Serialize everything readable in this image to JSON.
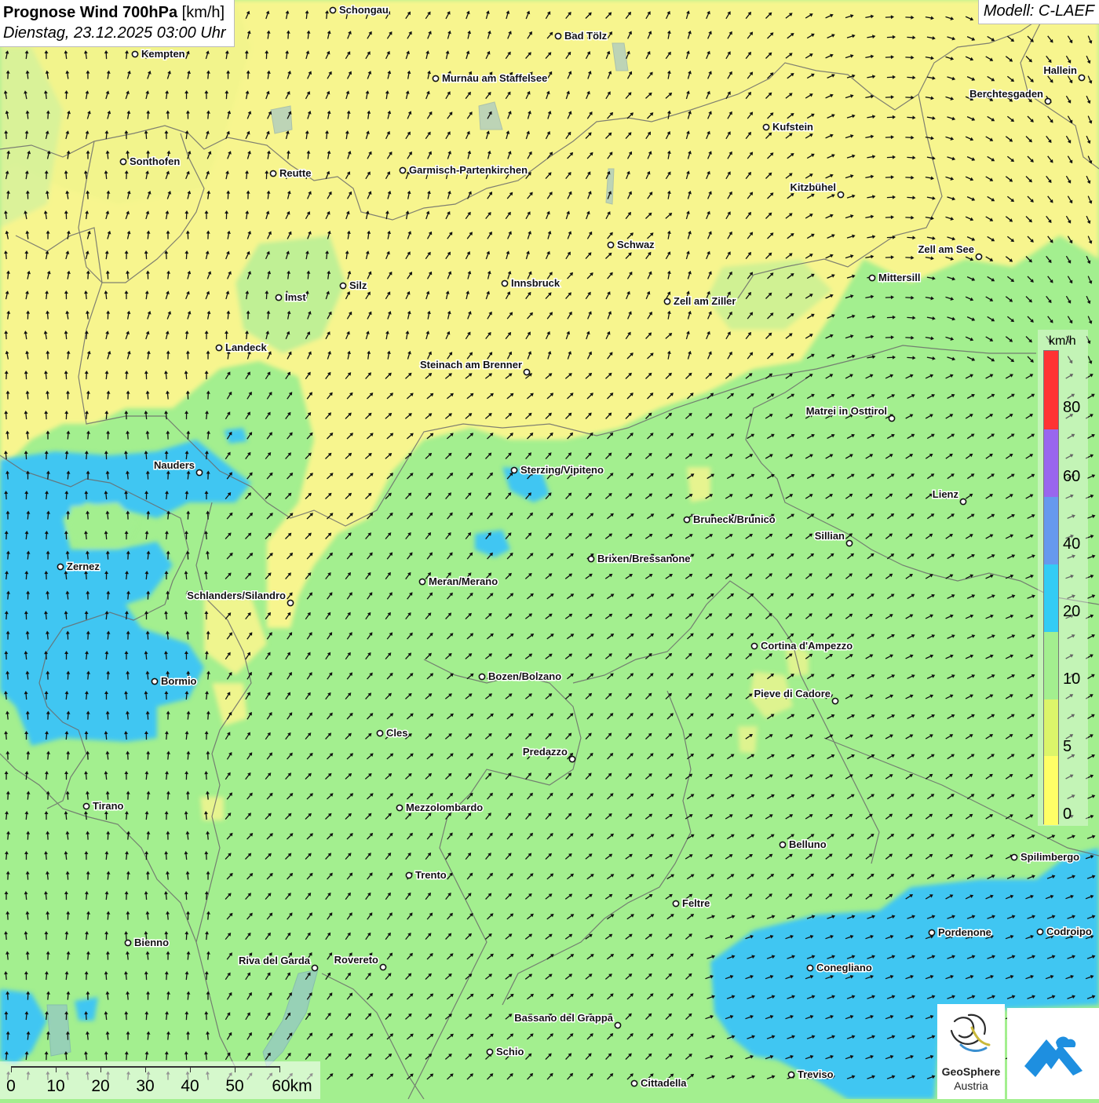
{
  "header": {
    "title_bold": "Prognose Wind 700hPa",
    "title_unit": "[km/h]",
    "datetime": "Dienstag, 23.12.2025 03:00 Uhr",
    "model": "Modell: C-LAEF"
  },
  "legend": {
    "unit": "km/h",
    "stops": [
      {
        "label": "0",
        "color": "#ffff66"
      },
      {
        "label": "5",
        "color": "#dcf56a"
      },
      {
        "label": "10",
        "color": "#a3ef8f"
      },
      {
        "label": "20",
        "color": "#33ccf5"
      },
      {
        "label": "40",
        "color": "#6699ee"
      },
      {
        "label": "60",
        "color": "#9966ee"
      },
      {
        "label": "80",
        "color": "#ff3333"
      }
    ]
  },
  "scalebar": {
    "labels": [
      "0",
      "10",
      "20",
      "30",
      "40",
      "50",
      "60km"
    ]
  },
  "colors": {
    "calm_yellow": "#f7f58e",
    "light_green": "#a3ef8f",
    "cyan_blue": "#3fc6f2",
    "border_gray": "#6b6b6b"
  },
  "places": [
    {
      "name": "Schongau",
      "side": "r"
    },
    {
      "name": "Bad Tölz",
      "side": "r"
    },
    {
      "name": "Kempten",
      "side": "r"
    },
    {
      "name": "Murnau am Staffelsee",
      "side": "r"
    },
    {
      "name": "Hallein",
      "side": "l"
    },
    {
      "name": "Berchtesgaden",
      "side": "l"
    },
    {
      "name": "Kufstein",
      "side": "r"
    },
    {
      "name": "Sonthofen",
      "side": "r"
    },
    {
      "name": "Reutte",
      "side": "r"
    },
    {
      "name": "Garmisch-Partenkirchen",
      "side": "r"
    },
    {
      "name": "Kitzbühel",
      "side": "l"
    },
    {
      "name": "Schwaz",
      "side": "r"
    },
    {
      "name": "Zell am See",
      "side": "l"
    },
    {
      "name": "Mittersill",
      "side": "r"
    },
    {
      "name": "Innsbruck",
      "side": "r"
    },
    {
      "name": "Silz",
      "side": "r"
    },
    {
      "name": "Imst",
      "side": "r"
    },
    {
      "name": "Zell am Ziller",
      "side": "r"
    },
    {
      "name": "Landeck",
      "side": "r"
    },
    {
      "name": "Steinach am Brenner",
      "side": "l"
    },
    {
      "name": "Matrei in Osttirol",
      "side": "l"
    },
    {
      "name": "Nauders",
      "side": "l"
    },
    {
      "name": "Sterzing/Vipiteno",
      "side": "r"
    },
    {
      "name": "Lienz",
      "side": "l"
    },
    {
      "name": "Bruneck/Brunico",
      "side": "r"
    },
    {
      "name": "Sillian",
      "side": "l"
    },
    {
      "name": "Zernez",
      "side": "r"
    },
    {
      "name": "Brixen/Bressanone",
      "side": "r"
    },
    {
      "name": "Meran/Merano",
      "side": "r"
    },
    {
      "name": "Schlanders/Silandro",
      "side": "l"
    },
    {
      "name": "Cortina d'Ampezzo",
      "side": "r"
    },
    {
      "name": "Bozen/Bolzano",
      "side": "r"
    },
    {
      "name": "Bormio",
      "side": "r"
    },
    {
      "name": "Pieve di Cadore",
      "side": "l"
    },
    {
      "name": "Cles",
      "side": "r"
    },
    {
      "name": "Predazzo",
      "side": "l"
    },
    {
      "name": "Tirano",
      "side": "r"
    },
    {
      "name": "Mezzolombardo",
      "side": "r"
    },
    {
      "name": "Belluno",
      "side": "r"
    },
    {
      "name": "Spilimbergo",
      "side": "r"
    },
    {
      "name": "Trento",
      "side": "r"
    },
    {
      "name": "Feltre",
      "side": "r"
    },
    {
      "name": "Pordenone",
      "side": "r"
    },
    {
      "name": "Codroipo",
      "side": "r"
    },
    {
      "name": "Bienno",
      "side": "r"
    },
    {
      "name": "Riva del Garda",
      "side": "l"
    },
    {
      "name": "Rovereto",
      "side": "l"
    },
    {
      "name": "Conegliano",
      "side": "r"
    },
    {
      "name": "Bassano del Grappa",
      "side": "l"
    },
    {
      "name": "Schio",
      "side": "r"
    },
    {
      "name": "Treviso",
      "side": "r"
    },
    {
      "name": "Cittadella",
      "side": "r"
    }
  ],
  "logos": {
    "geosphere_line1": "GeoSphere",
    "geosphere_line2": "Austria"
  }
}
